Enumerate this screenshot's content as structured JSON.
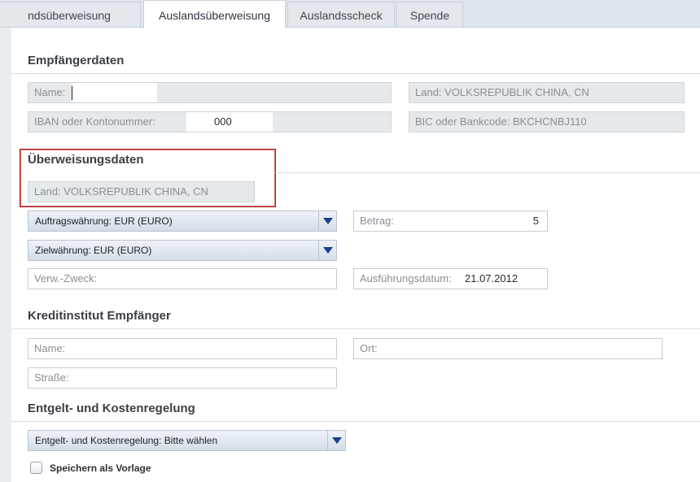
{
  "tabs": [
    {
      "label": "ndsüberweisung",
      "active": false
    },
    {
      "label": "Auslandsüberweisung",
      "active": true
    },
    {
      "label": "Auslandsscheck",
      "active": false
    },
    {
      "label": "Spende",
      "active": false
    }
  ],
  "recipient": {
    "title": "Empfängerdaten",
    "name_label": "Name:",
    "name_value": "",
    "country_label": "Land: VOLKSREPUBLIK CHINA, CN",
    "iban_label": "IBAN oder Kontonummer:",
    "iban_value": "000",
    "bic_label": "BIC oder Bankcode: BKCHCNBJ110"
  },
  "transfer": {
    "title": "Überweisungsdaten",
    "country_label": "Land: VOLKSREPUBLIK CHINA, CN",
    "order_currency": "Auftragswährung: EUR (EURO)",
    "target_currency": "Zielwährung: EUR (EURO)",
    "amount_label": "Betrag:",
    "amount_value": "5",
    "purpose_label": "Verw.-Zweck:",
    "purpose_value": "",
    "execution_label": "Ausführungsdatum:",
    "execution_value": "21.07.2012"
  },
  "bank": {
    "title": "Kreditinstitut Empfänger",
    "name_label": "Name:",
    "city_label": "Ort:",
    "street_label": "Straße:"
  },
  "fees": {
    "title": "Entgelt- und Kostenregelung",
    "select_label": "Entgelt- und Kostenregelung: Bitte wählen"
  },
  "save_template": {
    "label": "Speichern als Vorlage",
    "checked": false
  },
  "colors": {
    "highlight_border": "#a31d1d",
    "select_arrow": "#1c3f8a"
  },
  "icons": {
    "dropdown": "chevron-down-icon"
  }
}
